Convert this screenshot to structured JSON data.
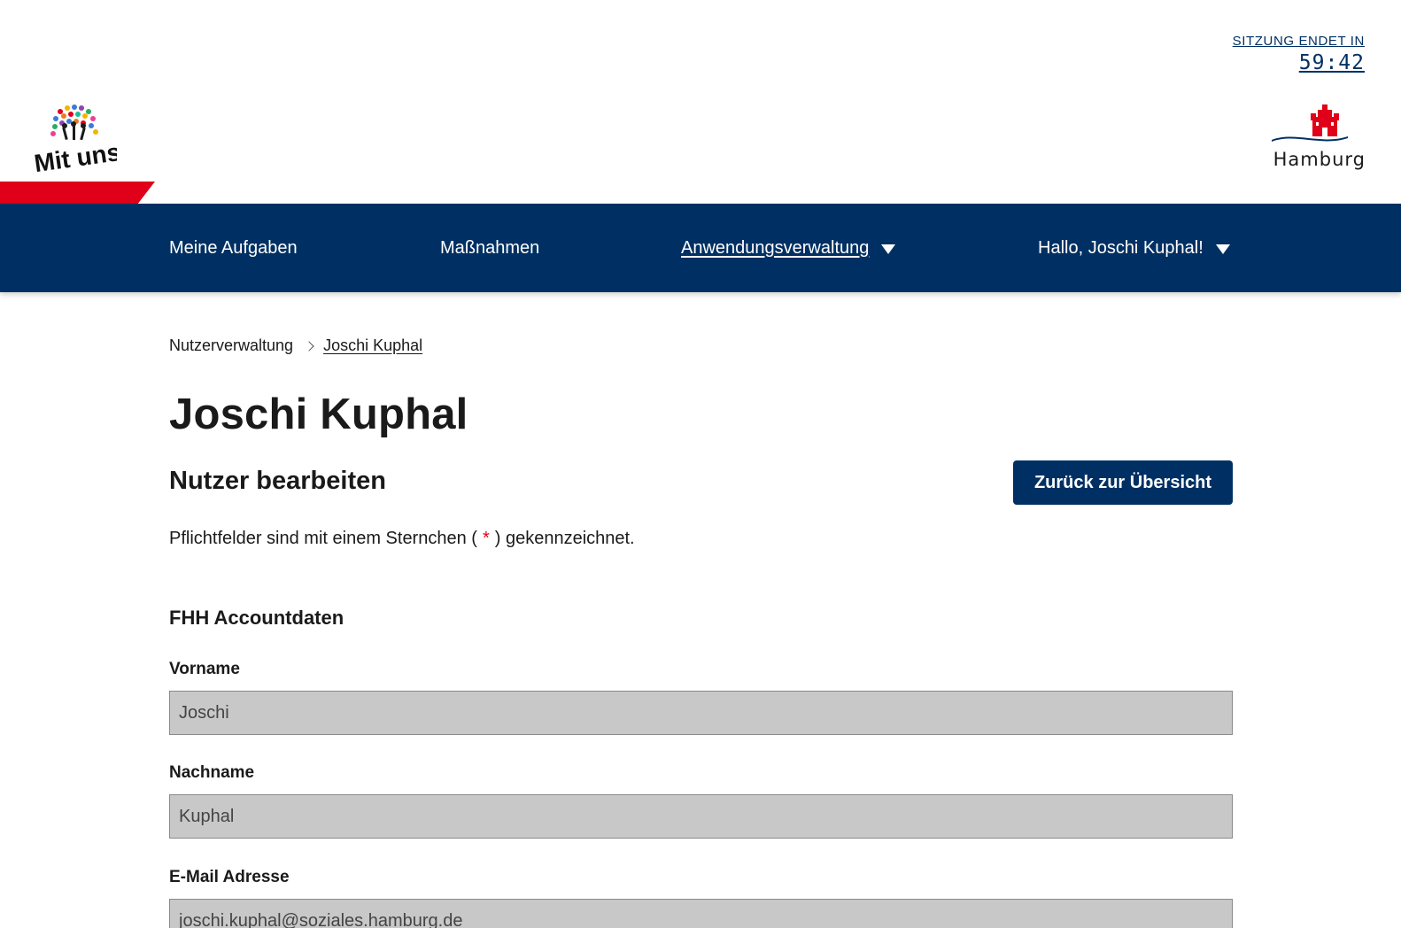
{
  "session": {
    "label": "SITZUNG ENDET IN",
    "time": "59:42"
  },
  "logos": {
    "left_name": "mit-uns-logo",
    "right_name": "hamburg-logo",
    "right_text": "Hamburg"
  },
  "nav": {
    "items": [
      {
        "label": "Meine Aufgaben"
      },
      {
        "label": "Maßnahmen"
      },
      {
        "label": "Anwendungsverwaltung"
      },
      {
        "label": "Hallo, Joschi Kuphal!"
      }
    ]
  },
  "breadcrumb": {
    "parent": "Nutzerverwaltung",
    "current": "Joschi Kuphal"
  },
  "page": {
    "title": "Joschi Kuphal",
    "section_title": "Nutzer bearbeiten",
    "back_button": "Zurück zur Übersicht",
    "required_before": "Pflichtfelder sind mit einem Sternchen (",
    "required_star": "*",
    "required_after": ") gekennzeichnet."
  },
  "form": {
    "fieldset_title": "FHH Accountdaten",
    "fields": [
      {
        "label": "Vorname",
        "value": "Joschi"
      },
      {
        "label": "Nachname",
        "value": "Kuphal"
      },
      {
        "label": "E-Mail Adresse",
        "value": "joschi.kuphal@soziales.hamburg.de"
      }
    ]
  },
  "colors": {
    "primary": "#003063",
    "accent_red": "#e10019",
    "input_bg": "#c8c8c8"
  }
}
